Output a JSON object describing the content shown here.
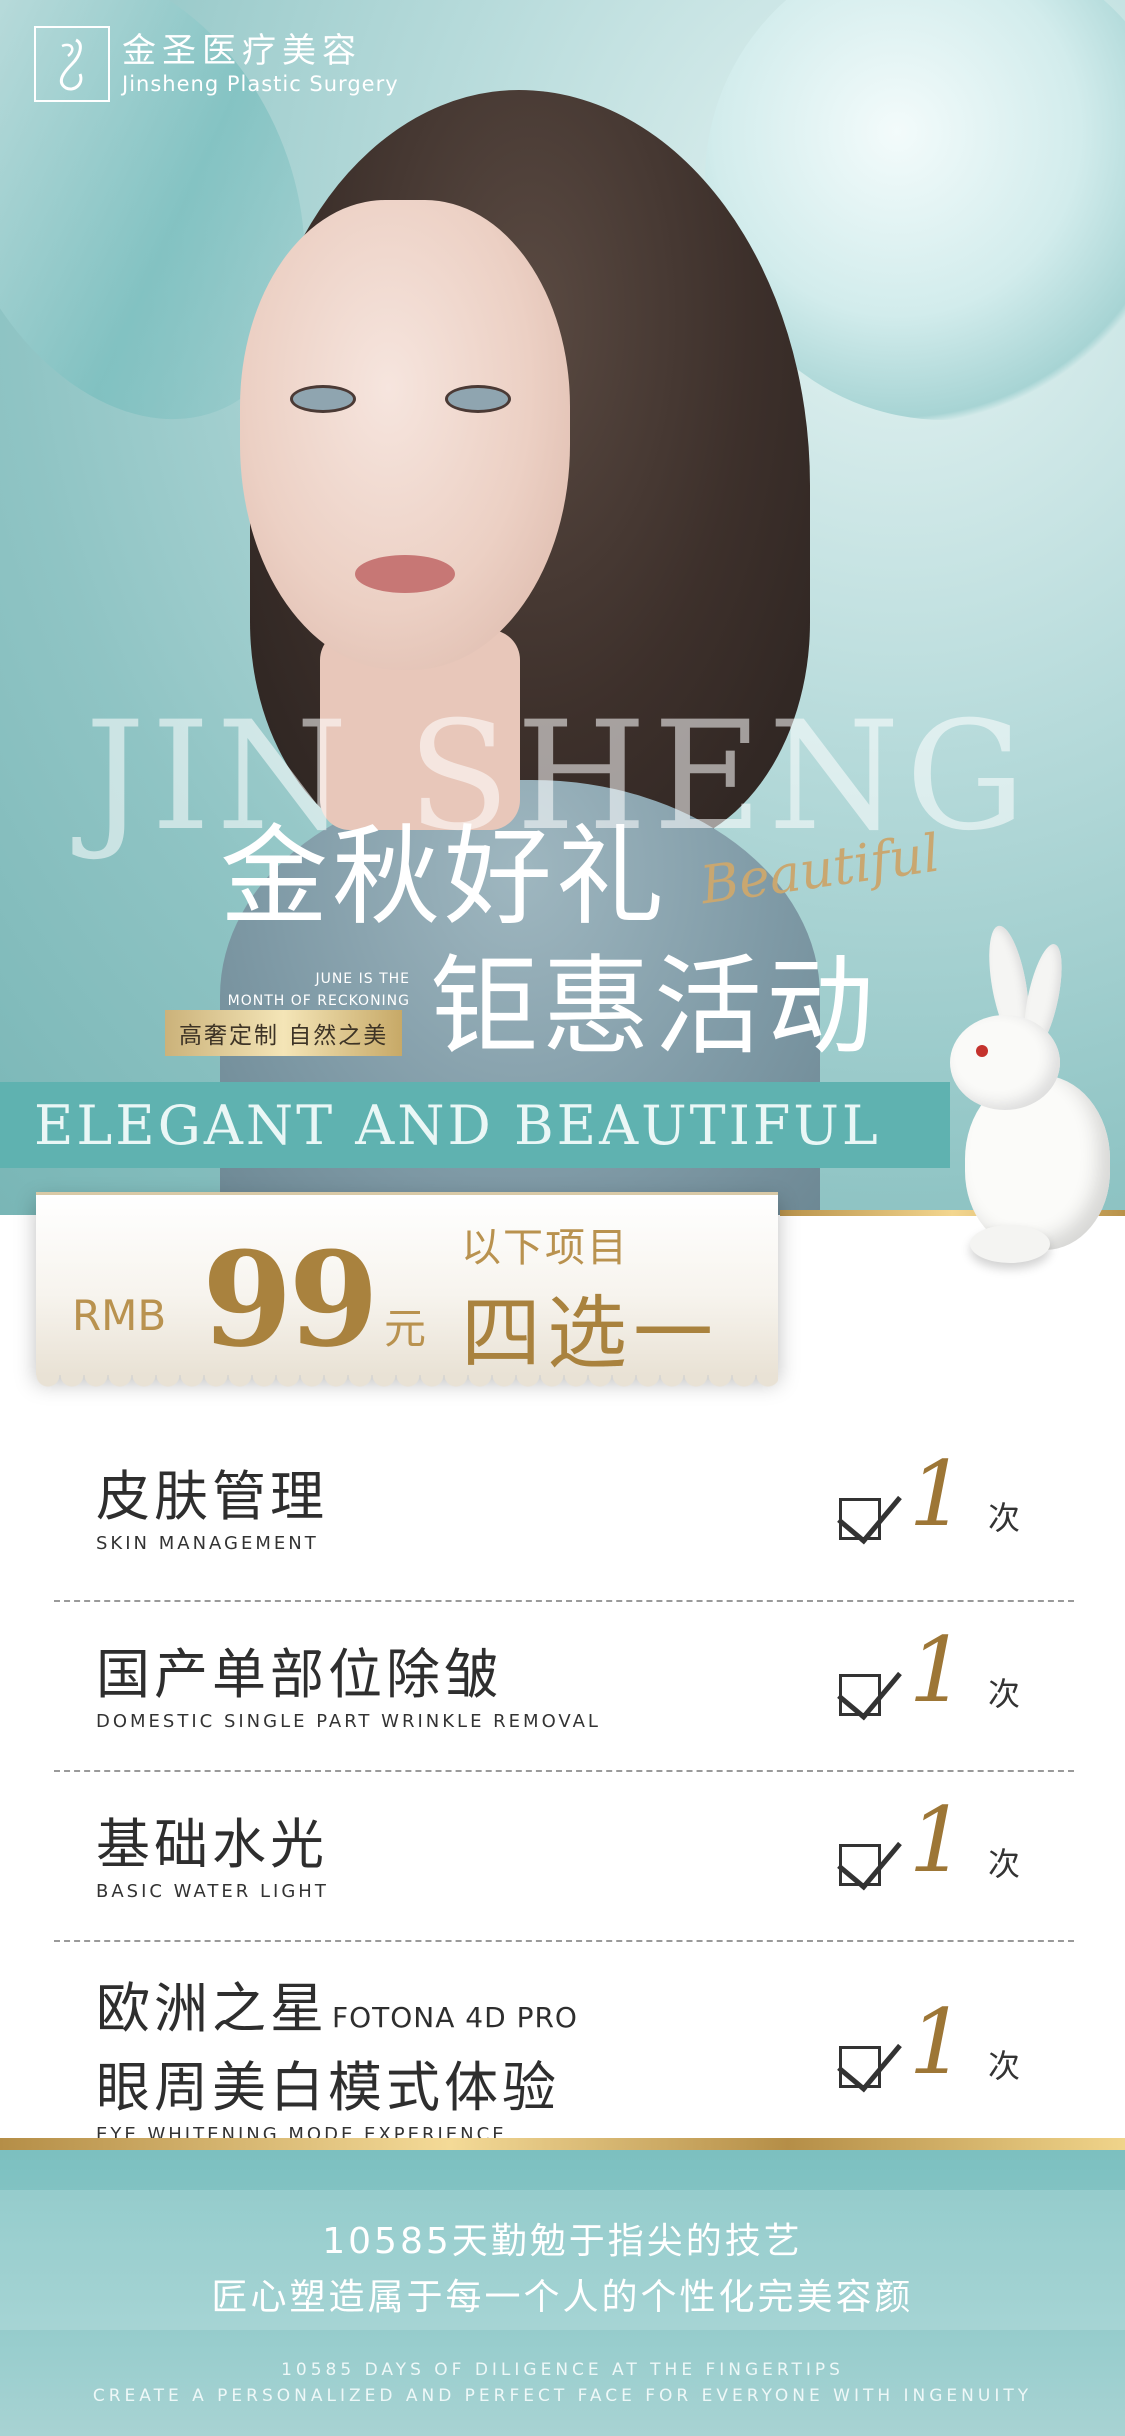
{
  "brand": {
    "name_cn": "金圣医疗美容",
    "name_en": "Jinsheng Plastic Surgery",
    "logo_letters": "JS"
  },
  "hero": {
    "watermark": "JIN SHENG",
    "title_line1": "金秋好礼",
    "title_line2": "钜惠活动",
    "script": "Beautiful",
    "tagline_en_line1": "JUNE IS THE",
    "tagline_en_line2": "MONTH OF RECKONING",
    "tag": "高奢定制 自然之美",
    "banner": "ELEGANT AND BEAUTIFUL"
  },
  "price": {
    "currency": "RMB",
    "amount": "99",
    "unit": "元",
    "subtitle": "以下项目",
    "choice": "四选一"
  },
  "items": [
    {
      "cn": "皮肤管理",
      "en": "SKIN MANAGEMENT",
      "count": "1",
      "unit": "次"
    },
    {
      "cn": "国产单部位除皱",
      "en": "DOMESTIC SINGLE PART WRINKLE REMOVAL",
      "count": "1",
      "unit": "次"
    },
    {
      "cn": "基础水光",
      "en": "BASIC WATER LIGHT",
      "count": "1",
      "unit": "次"
    },
    {
      "cn_line1": "欧洲之星",
      "cn_line1_en": "FOTONA 4D PRO",
      "cn_line2": "眼周美白模式体验",
      "en": "EYE WHITENING MODE EXPERIENCE",
      "count": "1",
      "unit": "次"
    }
  ],
  "footer": {
    "cn_line1": "10585天勤勉于指尖的技艺",
    "cn_line2": "匠心塑造属于每一个人的个性化完美容颜",
    "en_line1": "10585 DAYS OF DILIGENCE AT THE FINGERTIPS",
    "en_line2": "CREATE A PERSONALIZED AND PERFECT FACE FOR EVERYONE WITH INGENUITY"
  },
  "colors": {
    "teal": "#5fb2b0",
    "gold": "#a9823e",
    "text_dark": "#2e2e2e"
  }
}
